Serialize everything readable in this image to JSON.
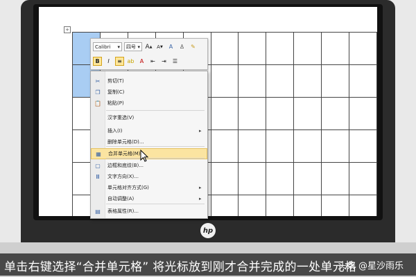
{
  "toolbar": {
    "font_name": "Calibri",
    "font_size": "四号",
    "grow_font": "A",
    "shrink_font": "A",
    "bold": "B",
    "italic": "I",
    "font_color_letter": "A"
  },
  "context_menu": {
    "items": [
      {
        "label": "剪切(T)",
        "icon": "scissors-icon",
        "has_submenu": false
      },
      {
        "label": "复制(C)",
        "icon": "copy-icon",
        "has_submenu": false
      },
      {
        "label": "粘贴(P)",
        "icon": "paste-icon",
        "has_submenu": false
      },
      {
        "label": "汉字重选(V)",
        "icon": "",
        "has_submenu": false
      },
      {
        "label": "插入(I)",
        "icon": "",
        "has_submenu": true
      },
      {
        "label": "删除单元格(D)...",
        "icon": "",
        "has_submenu": false
      },
      {
        "label": "合并单元格(M)",
        "icon": "merge-cells-icon",
        "has_submenu": false,
        "highlighted": true
      },
      {
        "label": "边框和底纹(B)...",
        "icon": "borders-icon",
        "has_submenu": false
      },
      {
        "label": "文字方向(X)...",
        "icon": "text-direction-icon",
        "has_submenu": false
      },
      {
        "label": "单元格对齐方式(G)",
        "icon": "",
        "has_submenu": true
      },
      {
        "label": "自动调整(A)",
        "icon": "",
        "has_submenu": true
      },
      {
        "label": "表格属性(R)...",
        "icon": "table-properties-icon",
        "has_submenu": false
      }
    ],
    "highlight_color": "#fbe4a1"
  },
  "table": {
    "rows": 6,
    "cols": 11,
    "selected_color": "#a9cdf3"
  },
  "brand": {
    "logo_text": "hp"
  },
  "caption": {
    "subtitle": "单击右键选择“合并单元格” 将光标放到刚才合并完成的一处单元格",
    "watermark": "头条 @星沙雨乐"
  }
}
